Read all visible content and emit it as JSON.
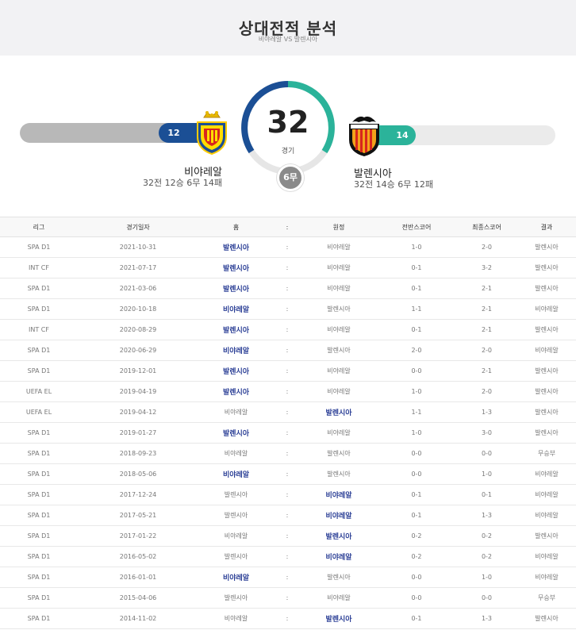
{
  "header": {
    "title": "상대전적 분석",
    "subtitle": "비야레알 VS 발렌시아"
  },
  "summary": {
    "total_games": "32",
    "games_label": "경기",
    "draws_label": "6무",
    "left_team": {
      "name": "비야레알",
      "record": "32전 12승 6무 14패",
      "wins": "12",
      "win_ratio": 0.375,
      "color": "#1b4f95"
    },
    "right_team": {
      "name": "발렌시아",
      "record": "32전 14승 6무 12패",
      "wins": "14",
      "win_ratio": 0.4375,
      "color": "#2bb39a"
    }
  },
  "table": {
    "headers": [
      "리그",
      "경기일자",
      "홈",
      ":",
      "원정",
      "전반스코어",
      "최종스코어",
      "결과"
    ],
    "rows": [
      {
        "league": "SPA D1",
        "date": "2021-10-31",
        "home": "발렌시아",
        "sep": ":",
        "away": "비야레알",
        "half": "1-0",
        "final": "2-0",
        "result": "발렌시아",
        "winner": "home"
      },
      {
        "league": "INT CF",
        "date": "2021-07-17",
        "home": "발렌시아",
        "sep": ":",
        "away": "비야레알",
        "half": "0-1",
        "final": "3-2",
        "result": "발렌시아",
        "winner": "home"
      },
      {
        "league": "SPA D1",
        "date": "2021-03-06",
        "home": "발렌시아",
        "sep": ":",
        "away": "비야레알",
        "half": "0-1",
        "final": "2-1",
        "result": "발렌시아",
        "winner": "home"
      },
      {
        "league": "SPA D1",
        "date": "2020-10-18",
        "home": "비야레알",
        "sep": ":",
        "away": "발렌시아",
        "half": "1-1",
        "final": "2-1",
        "result": "비야레알",
        "winner": "home"
      },
      {
        "league": "INT CF",
        "date": "2020-08-29",
        "home": "발렌시아",
        "sep": ":",
        "away": "비야레알",
        "half": "0-1",
        "final": "2-1",
        "result": "발렌시아",
        "winner": "home"
      },
      {
        "league": "SPA D1",
        "date": "2020-06-29",
        "home": "비야레알",
        "sep": ":",
        "away": "발렌시아",
        "half": "2-0",
        "final": "2-0",
        "result": "비야레알",
        "winner": "home"
      },
      {
        "league": "SPA D1",
        "date": "2019-12-01",
        "home": "발렌시아",
        "sep": ":",
        "away": "비야레알",
        "half": "0-0",
        "final": "2-1",
        "result": "발렌시아",
        "winner": "home"
      },
      {
        "league": "UEFA EL",
        "date": "2019-04-19",
        "home": "발렌시아",
        "sep": ":",
        "away": "비야레알",
        "half": "1-0",
        "final": "2-0",
        "result": "발렌시아",
        "winner": "home"
      },
      {
        "league": "UEFA EL",
        "date": "2019-04-12",
        "home": "비야레알",
        "sep": ":",
        "away": "발렌시아",
        "half": "1-1",
        "final": "1-3",
        "result": "발렌시아",
        "winner": "away"
      },
      {
        "league": "SPA D1",
        "date": "2019-01-27",
        "home": "발렌시아",
        "sep": ":",
        "away": "비야레알",
        "half": "1-0",
        "final": "3-0",
        "result": "발렌시아",
        "winner": "home"
      },
      {
        "league": "SPA D1",
        "date": "2018-09-23",
        "home": "비야레알",
        "sep": ":",
        "away": "발렌시아",
        "half": "0-0",
        "final": "0-0",
        "result": "무승부",
        "winner": "none"
      },
      {
        "league": "SPA D1",
        "date": "2018-05-06",
        "home": "비야레알",
        "sep": ":",
        "away": "발렌시아",
        "half": "0-0",
        "final": "1-0",
        "result": "비야레알",
        "winner": "home"
      },
      {
        "league": "SPA D1",
        "date": "2017-12-24",
        "home": "발렌시아",
        "sep": ":",
        "away": "비야레알",
        "half": "0-1",
        "final": "0-1",
        "result": "비야레알",
        "winner": "away"
      },
      {
        "league": "SPA D1",
        "date": "2017-05-21",
        "home": "발렌시아",
        "sep": ":",
        "away": "비야레알",
        "half": "0-1",
        "final": "1-3",
        "result": "비야레알",
        "winner": "away"
      },
      {
        "league": "SPA D1",
        "date": "2017-01-22",
        "home": "비야레알",
        "sep": ":",
        "away": "발렌시아",
        "half": "0-2",
        "final": "0-2",
        "result": "발렌시아",
        "winner": "away"
      },
      {
        "league": "SPA D1",
        "date": "2016-05-02",
        "home": "발렌시아",
        "sep": ":",
        "away": "비야레알",
        "half": "0-2",
        "final": "0-2",
        "result": "비야레알",
        "winner": "away"
      },
      {
        "league": "SPA D1",
        "date": "2016-01-01",
        "home": "비야레알",
        "sep": ":",
        "away": "발렌시아",
        "half": "0-0",
        "final": "1-0",
        "result": "비야레알",
        "winner": "home"
      },
      {
        "league": "SPA D1",
        "date": "2015-04-06",
        "home": "발렌시아",
        "sep": ":",
        "away": "비야레알",
        "half": "0-0",
        "final": "0-0",
        "result": "무승부",
        "winner": "none"
      },
      {
        "league": "SPA D1",
        "date": "2014-11-02",
        "home": "비야레알",
        "sep": ":",
        "away": "발렌시아",
        "half": "0-1",
        "final": "1-3",
        "result": "발렌시아",
        "winner": "away"
      }
    ]
  }
}
